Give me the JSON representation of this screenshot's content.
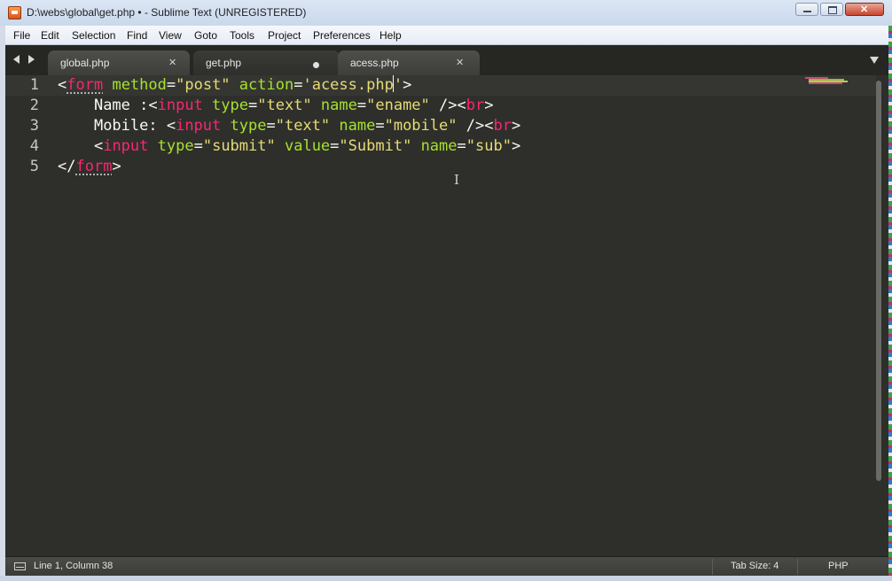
{
  "window": {
    "title": "D:\\webs\\global\\get.php • - Sublime Text (UNREGISTERED)"
  },
  "menu": [
    {
      "label": "File"
    },
    {
      "label": "Edit"
    },
    {
      "label": "Selection"
    },
    {
      "label": "Find"
    },
    {
      "label": "View"
    },
    {
      "label": "Goto"
    },
    {
      "label": "Tools"
    },
    {
      "label": "Project"
    },
    {
      "label": "Preferences"
    },
    {
      "label": "Help"
    }
  ],
  "tabs": [
    {
      "label": "global.php",
      "active": false,
      "modified": false
    },
    {
      "label": "get.php",
      "active": true,
      "modified": true
    },
    {
      "label": "acess.php",
      "active": false,
      "modified": false
    }
  ],
  "editor": {
    "line_numbers": [
      "1",
      "2",
      "3",
      "4",
      "5"
    ]
  },
  "status": {
    "position": "Line 1, Column 38",
    "tab_size": "Tab Size: 4",
    "syntax": "PHP"
  },
  "theme": {
    "background": "#2e2f2b",
    "tag_color": "#f92672",
    "attr_color": "#a6e22e",
    "string_color": "#e6db74"
  }
}
